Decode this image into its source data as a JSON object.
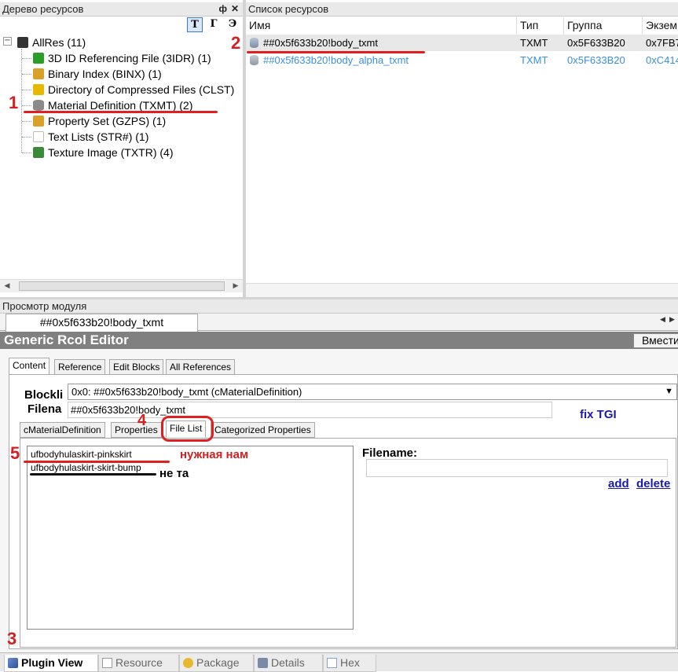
{
  "left_panel": {
    "title": "Дерево ресурсов",
    "pin_glyph": "ф",
    "close_glyph": "✕",
    "toolbar": [
      "Т",
      "Г",
      "Э"
    ],
    "tree": [
      {
        "label": "AllRes (11)",
        "icon": "cube-icon",
        "color": "#333333"
      },
      {
        "label": "3D ID Referencing File (3IDR) (1)",
        "icon": "download-icon",
        "color": "#2a9d2a"
      },
      {
        "label": "Binary Index (BINX) (1)",
        "icon": "index-icon",
        "color": "#d9a02a"
      },
      {
        "label": "Directory of Compressed Files (CLST)",
        "icon": "folder-gear-icon",
        "color": "#e6b800"
      },
      {
        "label": "Material Definition (TXMT) (2)",
        "icon": "database-icon",
        "color": "#8a8a8a"
      },
      {
        "label": "Property Set (GZPS) (1)",
        "icon": "property-icon",
        "color": "#d9a02a"
      },
      {
        "label": "Text Lists (STR#) (1)",
        "icon": "document-icon",
        "color": "#bbbbbb"
      },
      {
        "label": "Texture Image (TXTR) (4)",
        "icon": "image-icon",
        "color": "#3a8a3a"
      }
    ]
  },
  "right_panel": {
    "title": "Список ресурсов",
    "columns": [
      "Имя",
      "Тип",
      "Группа",
      "Экзем"
    ],
    "rows": [
      {
        "name": "##0x5f633b20!body_txmt",
        "type": "TXMT",
        "group": "0x5F633B20",
        "instance": "0x7FB7",
        "selected": true
      },
      {
        "name": "##0x5f633b20!body_alpha_txmt",
        "type": "TXMT",
        "group": "0x5F633B20",
        "instance": "0xC414",
        "selected": false
      }
    ]
  },
  "module_view": {
    "title": "Просмотр модуля",
    "doc_tab": "##0x5f633b20!body_txmt",
    "editor_title": "Generic Rcol Editor",
    "insert_button": "Вмести",
    "tabs": [
      "Content",
      "Reference",
      "Edit Blocks",
      "All References"
    ],
    "blocklist_label": "Blockli",
    "blocklist_value": "0x0: ##0x5f633b20!body_txmt (cMaterialDefinition)",
    "filename_label": "Filena",
    "filename_value": "##0x5f633b20!body_txmt",
    "fix_tgi": "fix TGI",
    "subtabs": [
      "cMaterialDefinition",
      "Properties",
      "File List",
      "Categorized Properties"
    ],
    "files": [
      "ufbodyhulaskirt-pinkskirt",
      "ufbodyhulaskirt-skirt-bump"
    ],
    "filename_field_label": "Filename:",
    "add_link": "add",
    "delete_link": "delete"
  },
  "annotations": {
    "n1": "1",
    "n2": "2",
    "n3": "3",
    "n4": "4",
    "n5": "5",
    "needed": "нужная нам",
    "not_it": "не та"
  },
  "bottom_tabs": [
    {
      "label": "Plugin View",
      "icon": "plugin-icon"
    },
    {
      "label": "Resource",
      "icon": "resource-icon"
    },
    {
      "label": "Package",
      "icon": "package-icon"
    },
    {
      "label": "Details",
      "icon": "details-icon"
    },
    {
      "label": "Hex",
      "icon": "hex-icon"
    }
  ],
  "colors": {
    "accent_red": "#e02020",
    "link_blue": "#1a1aaa",
    "row_blue": "#3a8ee0",
    "header_gray": "#808080"
  }
}
